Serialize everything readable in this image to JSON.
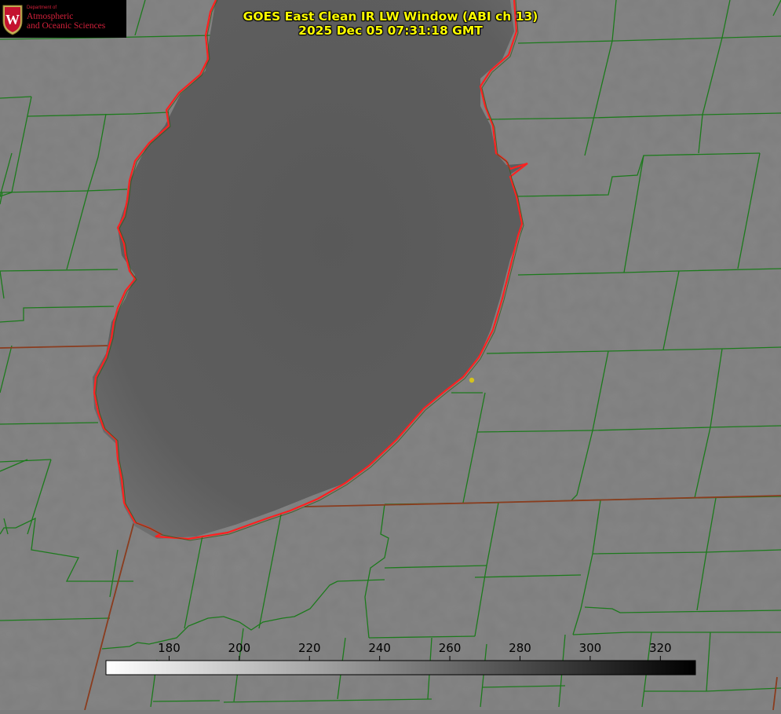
{
  "header": {
    "title_line1": "GOES East Clean IR LW Window (ABI ch 13)",
    "title_line2": "2025 Dec 05 07:31:18 GMT"
  },
  "logo": {
    "department_line": "Department of",
    "name_line1": "Atmospheric",
    "name_line2": "and Oceanic Sciences",
    "crest_letter": "W"
  },
  "colorbar": {
    "min": 162,
    "max": 330,
    "ticks": [
      "180",
      "200",
      "220",
      "240",
      "260",
      "280",
      "300",
      "320"
    ],
    "tick_values": [
      180,
      200,
      220,
      240,
      260,
      280,
      300,
      320
    ],
    "colormap": "white-to-black"
  },
  "colors": {
    "land": "#7e7e7e",
    "lake": "#5c5c5c",
    "county_lines": "#1a7a1a",
    "state_lines": "#8b3a1a",
    "shoreline": "#ff2020",
    "title": "#ffff00",
    "marker": "#d4c21e"
  }
}
